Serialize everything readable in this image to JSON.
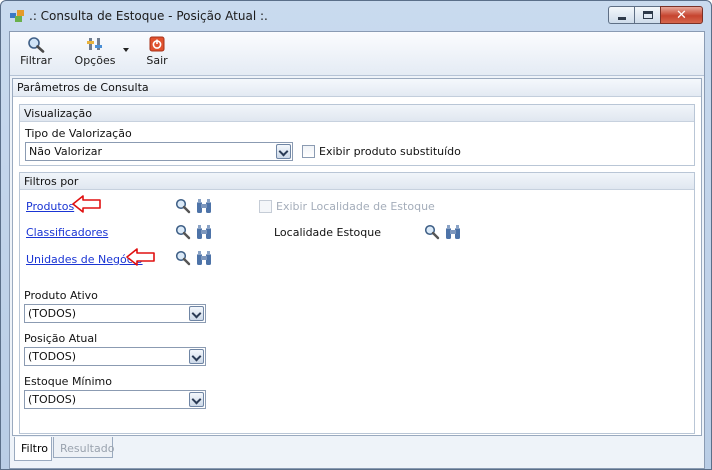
{
  "window": {
    "title": ".: Consulta de Estoque - Posição Atual :."
  },
  "toolbar": {
    "filter_label": "Filtrar",
    "options_label": "Opções",
    "exit_label": "Sair"
  },
  "panel": {
    "title": "Parâmetros de Consulta"
  },
  "visualizacao": {
    "group_title": "Visualização",
    "tipo_label": "Tipo de Valorização",
    "tipo_value": "Não Valorizar",
    "substituto_label": "Exibir produto substituído"
  },
  "filtros": {
    "group_title": "Filtros por",
    "produtos_link": "Produtos",
    "classificadores_link": "Classificadores",
    "unidades_link": "Unidades de Negócio",
    "exibir_localidade_label": "Exibir Localidade de Estoque",
    "localidade_label": "Localidade Estoque",
    "produto_ativo_label": "Produto Ativo",
    "produto_ativo_value": "(TODOS)",
    "posicao_atual_label": "Posição Atual",
    "posicao_atual_value": "(TODOS)",
    "estoque_minimo_label": "Estoque Mínimo",
    "estoque_minimo_value": "(TODOS)"
  },
  "tabs": {
    "filtro": "Filtro",
    "resultado": "Resultado"
  },
  "colors": {
    "link": "#1a35d4",
    "annotation_arrow": "#e01010",
    "close_button": "#c6442f"
  },
  "icons": [
    "app-icon",
    "magnifier-icon",
    "options-icon",
    "exit-icon",
    "search-icon",
    "binoculars-icon",
    "red-arrow-annotation"
  ]
}
